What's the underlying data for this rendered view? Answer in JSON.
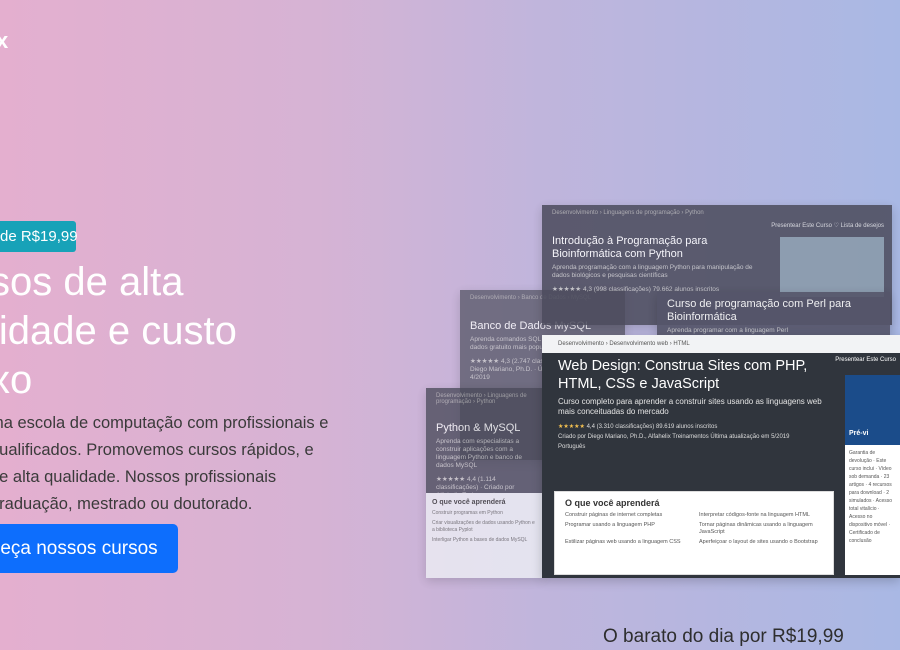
{
  "brand": "x",
  "hero": {
    "price_badge": "de R$19,99",
    "title": "sos de alta lidade e custo xo",
    "description": "ma escola de computação com profissionais e qualificados. Promovemos cursos rápidos, e de alta qualidade. Nossos profissionais graduação, mestrado ou doutorado.",
    "cta_label": "eça nossos cursos"
  },
  "deal_text": "O barato do dia por R$19,99",
  "collage": {
    "mysql": {
      "crumbs": "Desenvolvimento  ›  Banco de Dados  ›  MySQL",
      "title": "Banco de Dados MySQL",
      "subtitle": "Aprenda comandos SQL no MySQL, o banco de dados gratuito mais popular do mundo",
      "meta": "★★★★★ 4,3 (2.747 classificações)  ·  Criado por Diego Mariano, Ph.D.  ·  Última atualização em 4/2019"
    },
    "python": {
      "crumbs": "Desenvolvimento  ›  Linguagens de programação  ›  Python",
      "title": "Python & MySQL",
      "subtitle": "Aprenda com especialistas a construir aplicações com a linguagem Python e banco de dados MySQL",
      "meta": "★★★★★ 4,4 (1.114 classificações) · Criado por Alfahelix Treinamentos",
      "learn_title": "O que você aprenderá",
      "learn_items": [
        "Construir programas em Python",
        "Criar visualizações de dados usando Python e a biblioteca Pyplot",
        "Interligar Python a bases de dados MySQL"
      ]
    },
    "bio": {
      "crumbs": "Desenvolvimento  ›  Linguagens de programação  ›  Python",
      "title": "Introdução à Programação para Bioinformática com Python",
      "subtitle": "Aprenda programação com a linguagem Python para manipulação de dados biológicos e pesquisas científicas",
      "meta": "★★★★★ 4,3 (998 classificações)  79.662 alunos inscritos",
      "buttons": "Presentear Este Curso   ♡ Lista de desejos"
    },
    "perl": {
      "title": "Curso de programação com Perl para Bioinformática",
      "subtitle": "Aprenda programar com a linguagem Perl"
    },
    "web": {
      "crumbs": "Desenvolvimento  ›  Desenvolvimento web  ›  HTML",
      "gift": "Presentear Este Curso",
      "title": "Web Design: Construa Sites com PHP, HTML, CSS e JavaScript",
      "subtitle": "Curso completo para aprender a construir sites usando as linguagens web mais conceituadas do mercado",
      "rating": "★★★★★",
      "rating_text": "4,4 (3.310 classificações)   89.619 alunos inscritos",
      "creators": "Criado por Diego Mariano, Ph.D., Alfahelix Treinamentos    Última atualização em 5/2019",
      "language": "Português",
      "learn_title": "O que você aprenderá",
      "learn_items": [
        "Construir páginas de internet completas",
        "Interpretar códigos-fonte na linguagem HTML",
        "Programar usando a linguagem PHP",
        "Tornar páginas dinâmicas usando a linguagem JavaScript",
        "Estilizar páginas web usando a linguagem CSS",
        "Aperfeiçoar o layout de sites usando o Bootstrap"
      ],
      "side_video_label": "Pré-vi",
      "side_info": "Garantia de devolução · Este curso inclui · Vídeo sob demanda · 23 artigos · 4 recursos para download · 2 simulados · Acesso total vitalício · Acesso no dispositivo móvel · Certificado de conclusão"
    }
  }
}
